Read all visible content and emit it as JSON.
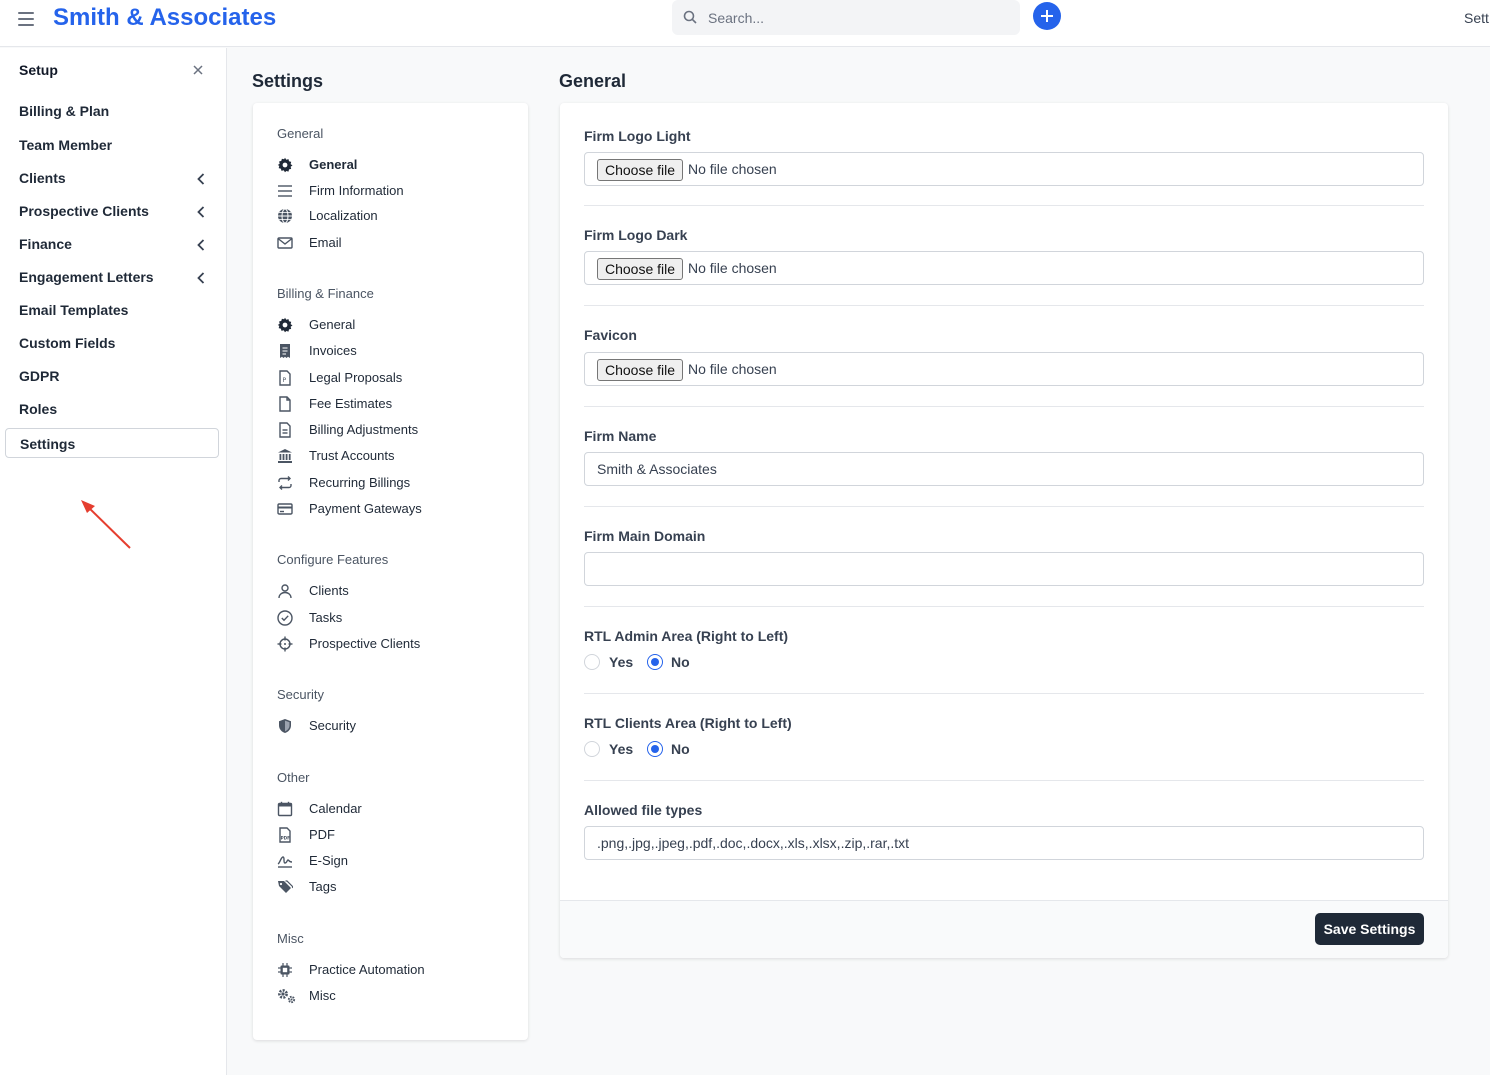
{
  "topbar": {
    "brand": "Smith & Associates",
    "search_placeholder": "Search...",
    "right_text": "Sett"
  },
  "sidebar": {
    "heading": "Setup",
    "items": [
      {
        "label": "Billing & Plan",
        "has_children": false
      },
      {
        "label": "Team Member",
        "has_children": false
      },
      {
        "label": "Clients",
        "has_children": true
      },
      {
        "label": "Prospective Clients",
        "has_children": true
      },
      {
        "label": "Finance",
        "has_children": true
      },
      {
        "label": "Engagement Letters",
        "has_children": true
      },
      {
        "label": "Email Templates",
        "has_children": false
      },
      {
        "label": "Custom Fields",
        "has_children": false
      },
      {
        "label": "GDPR",
        "has_children": false
      },
      {
        "label": "Roles",
        "has_children": false
      },
      {
        "label": "Settings",
        "has_children": false,
        "active": true
      }
    ]
  },
  "settings_menu": {
    "title": "Settings",
    "groups": [
      {
        "title": "General",
        "items": [
          {
            "label": "General",
            "icon": "gear-icon",
            "active": true
          },
          {
            "label": "Firm Information",
            "icon": "lines-icon"
          },
          {
            "label": "Localization",
            "icon": "globe-icon"
          },
          {
            "label": "Email",
            "icon": "envelope-icon"
          }
        ]
      },
      {
        "title": "Billing & Finance",
        "items": [
          {
            "label": "General",
            "icon": "gear-icon"
          },
          {
            "label": "Invoices",
            "icon": "invoice-icon"
          },
          {
            "label": "Legal Proposals",
            "icon": "proposal-icon"
          },
          {
            "label": "Fee Estimates",
            "icon": "file-icon"
          },
          {
            "label": "Billing Adjustments",
            "icon": "document-icon"
          },
          {
            "label": "Trust Accounts",
            "icon": "bank-icon"
          },
          {
            "label": "Recurring Billings",
            "icon": "repeat-icon"
          },
          {
            "label": "Payment Gateways",
            "icon": "credit-card-icon"
          }
        ]
      },
      {
        "title": "Configure Features",
        "items": [
          {
            "label": "Clients",
            "icon": "user-icon"
          },
          {
            "label": "Tasks",
            "icon": "check-circle-icon"
          },
          {
            "label": "Prospective Clients",
            "icon": "crosshair-icon"
          }
        ]
      },
      {
        "title": "Security",
        "items": [
          {
            "label": "Security",
            "icon": "shield-icon"
          }
        ]
      },
      {
        "title": "Other",
        "items": [
          {
            "label": "Calendar",
            "icon": "calendar-icon"
          },
          {
            "label": "PDF",
            "icon": "pdf-icon"
          },
          {
            "label": "E-Sign",
            "icon": "signature-icon"
          },
          {
            "label": "Tags",
            "icon": "tags-icon"
          }
        ]
      },
      {
        "title": "Misc",
        "items": [
          {
            "label": "Practice Automation",
            "icon": "chip-icon"
          },
          {
            "label": "Misc",
            "icon": "cogs-icon"
          }
        ]
      }
    ]
  },
  "general_form": {
    "title": "General",
    "file_button_label": "Choose file",
    "file_status": "No file chosen",
    "firm_logo_light_label": "Firm Logo Light",
    "firm_logo_dark_label": "Firm Logo Dark",
    "favicon_label": "Favicon",
    "firm_name_label": "Firm Name",
    "firm_name_value": "Smith & Associates",
    "firm_main_domain_label": "Firm Main Domain",
    "firm_main_domain_value": "",
    "rtl_admin_label": "RTL Admin Area (Right to Left)",
    "rtl_clients_label": "RTL Clients Area (Right to Left)",
    "yes_label": "Yes",
    "no_label": "No",
    "rtl_admin_value": "No",
    "rtl_clients_value": "No",
    "allowed_file_types_label": "Allowed file types",
    "allowed_file_types_value": ".png,.jpg,.jpeg,.pdf,.doc,.docx,.xls,.xlsx,.zip,.rar,.txt",
    "save_button_label": "Save Settings"
  },
  "colors": {
    "brand": "#2563eb",
    "save_button": "#1f2937",
    "annotation_arrow": "#e53e2f"
  }
}
